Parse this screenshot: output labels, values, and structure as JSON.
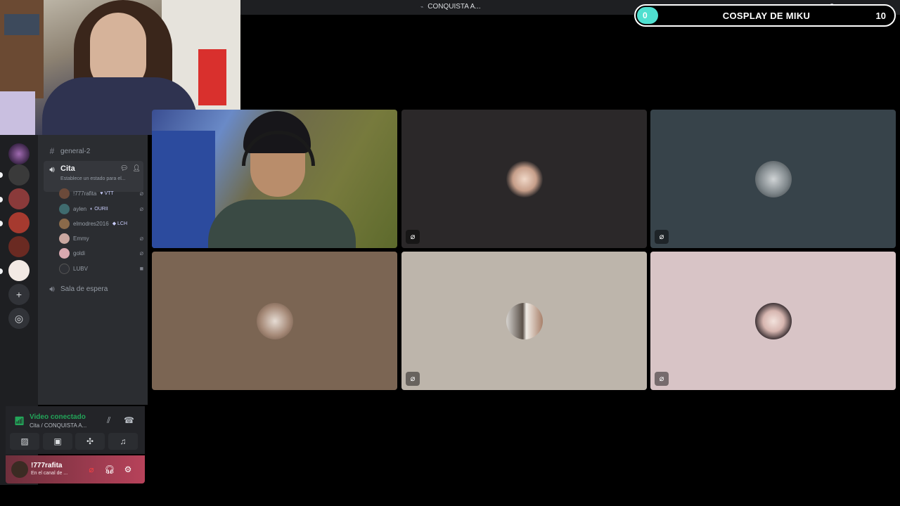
{
  "window": {
    "title": "CONQUISTA A...",
    "title_prefix": "⌁"
  },
  "overlay": {
    "progress_start": "0",
    "progress_title": "COSPLAY DE MIKU",
    "progress_end": "10",
    "progress_value": 0,
    "accent": "#4fe0d0"
  },
  "sidebar": {
    "channels": [
      {
        "icon": "hash-icon",
        "label": "general-2"
      },
      {
        "icon": "speaker-icon",
        "label": "Cita",
        "status": "Establece un estado para el..."
      },
      {
        "icon": "speaker-icon",
        "label": "Sala de espera"
      }
    ],
    "voice_users": [
      {
        "name": "!777rafita",
        "badge": "♥ VTT",
        "color": "#6b4a3a"
      },
      {
        "name": "aylen",
        "badge": "◐ OURII",
        "color": "#3f6b6e"
      },
      {
        "name": "elmodres2016",
        "badge": "◆ LCH",
        "color": "#8a6a4a"
      },
      {
        "name": "Emmy",
        "badge": "",
        "color": "#c9a7a0"
      },
      {
        "name": "goldi",
        "badge": "",
        "color": "#d9a9b0"
      },
      {
        "name": "LUBV",
        "badge": "",
        "color": "#2f3136"
      }
    ]
  },
  "voice_panel": {
    "title": "Video conectado",
    "subtitle": "Cita / CONQUISTA A..."
  },
  "user": {
    "name": "!777rafita",
    "status": "En el canal de ..."
  },
  "tiles": [
    {
      "name": "camera",
      "color": "#3a4e92"
    },
    {
      "name": "avatar-1",
      "color": "#2b2829",
      "avatar_color": "#e8c9b5"
    },
    {
      "name": "avatar-2",
      "color": "#37434a",
      "avatar_color": "#9aa3a8"
    },
    {
      "name": "avatar-3",
      "color": "#7b6553",
      "avatar_color": "#b89a86"
    },
    {
      "name": "avatar-4",
      "color": "#bdb5ab",
      "avatar_color": "#8a7e74"
    },
    {
      "name": "avatar-5",
      "color": "#d8c4c6",
      "avatar_color": "#e6d2d0"
    }
  ]
}
